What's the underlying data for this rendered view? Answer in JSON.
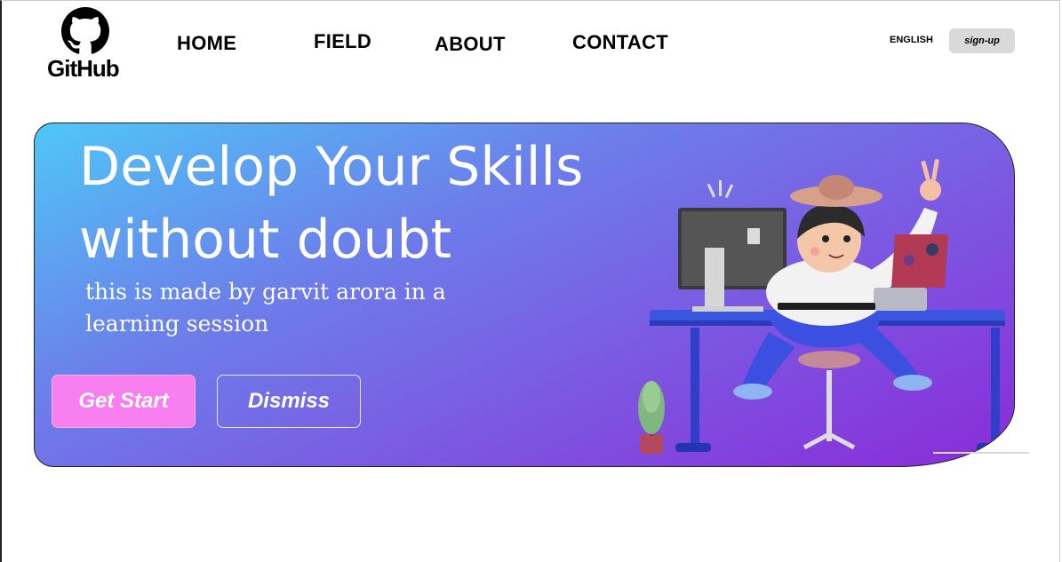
{
  "brand": {
    "logo_text": "GitHub",
    "logo_icon": "github-octocat-icon"
  },
  "nav": {
    "items": [
      {
        "label": "HOME"
      },
      {
        "label": "FIELD"
      },
      {
        "label": "ABOUT"
      },
      {
        "label": "CONTACT"
      }
    ],
    "language": "ENGLISH",
    "signup_label": "sign-up"
  },
  "hero": {
    "title": "Develop Your Skills without doubt",
    "subtitle": "this is made by garvit arora in a learning session",
    "primary_button": "Get Start",
    "secondary_button": "Dismiss",
    "illustration_icon": "developer-at-desk-illustration"
  },
  "colors": {
    "gradient_start": "#4fc7f7",
    "gradient_mid": "#7a5ee3",
    "gradient_end": "#8a2bd9",
    "primary_button": "#f77ff0",
    "signup_bg": "#d9d9d9"
  }
}
